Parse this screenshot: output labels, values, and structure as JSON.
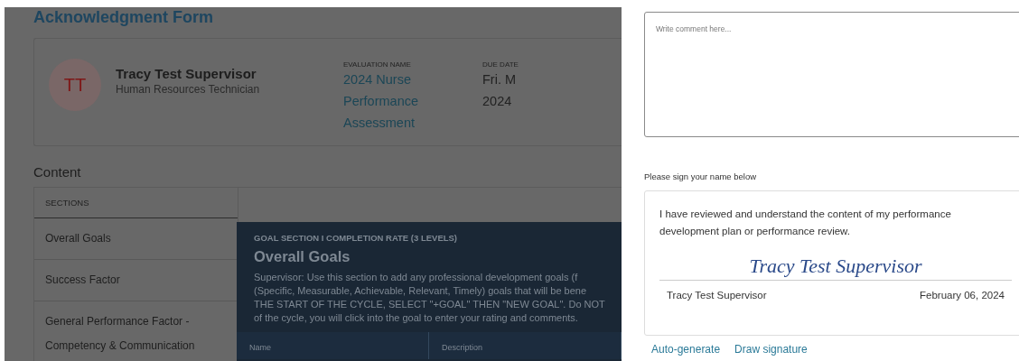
{
  "form": {
    "title": "Acknowledgment Form",
    "person": {
      "initials": "TT",
      "name": "Tracy Test Supervisor",
      "role": "Human Resources Technician"
    },
    "fields": [
      {
        "label": "EVALUATION NAME",
        "value_lines": [
          "2024 Nurse",
          "Performance",
          "Assessment"
        ]
      },
      {
        "label": "DUE DATE",
        "value_lines": [
          "Fri. M",
          "2024"
        ]
      }
    ],
    "content_heading": "Content",
    "sections_header": "SECTIONS",
    "sections": [
      {
        "label": "Overall Goals"
      },
      {
        "label": "Success Factor"
      },
      {
        "label": "General Performance Factor - Competency & Communication"
      }
    ],
    "goal_card": {
      "overline": "GOAL SECTION I COMPLETION RATE (3 LEVELS)",
      "title": "Overall Goals",
      "description_lines": [
        "Supervisor: Use this section to add any professional development goals (f",
        "(Specific, Measurable, Achievable, Relevant, Timely) goals that will be bene",
        "THE START OF THE CYCLE, SELECT \"+GOAL\" THEN \"NEW GOAL\". Do NOT",
        "of the cycle, you will click into the goal to enter your rating and comments."
      ],
      "columns": [
        "Name",
        "Description"
      ]
    }
  },
  "sign_panel": {
    "comment": {
      "placeholder": "Write comment here..."
    },
    "sign_prompt": "Please sign your name below",
    "statement": "I have reviewed and understand the content of my performance development plan or performance review.",
    "signature": "Tracy Test Supervisor",
    "signer": "Tracy Test Supervisor",
    "date": "February 06, 2024",
    "links": [
      "Auto-generate",
      "Draw signature"
    ]
  }
}
